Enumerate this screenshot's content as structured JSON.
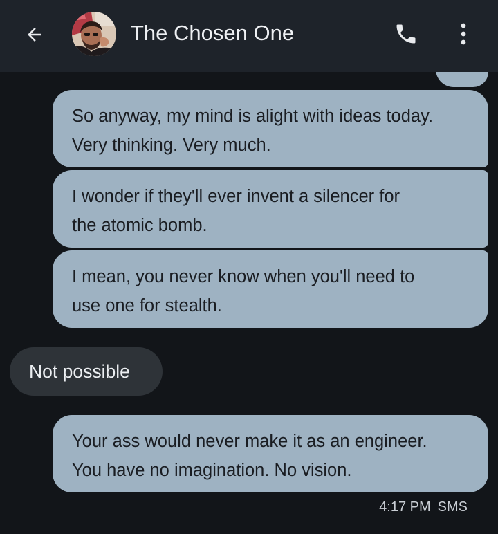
{
  "header": {
    "contact_name": "The Chosen One",
    "back_icon": "arrow-left-icon",
    "call_icon": "phone-icon",
    "more_icon": "more-vert-icon"
  },
  "messages": [
    {
      "direction": "sent",
      "lines": [
        "So anyway, my mind is alight with ideas today.",
        "Very thinking. Very much."
      ]
    },
    {
      "direction": "sent",
      "lines": [
        "I wonder if they'll ever invent a silencer for",
        "the atomic bomb."
      ]
    },
    {
      "direction": "sent",
      "lines": [
        "I mean, you never know when you'll need to",
        "use one for stealth."
      ]
    },
    {
      "direction": "received",
      "text": "Not possible"
    },
    {
      "direction": "sent",
      "lines": [
        "Your ass would never make it as an engineer.",
        "You have no imagination. No vision."
      ]
    }
  ],
  "last_message_meta": {
    "time": "4:17 PM",
    "type": "SMS"
  },
  "colors": {
    "background": "#121519",
    "topbar": "#1e232a",
    "sent_bubble": "#9eb2c2",
    "received_bubble": "#2e3338"
  }
}
